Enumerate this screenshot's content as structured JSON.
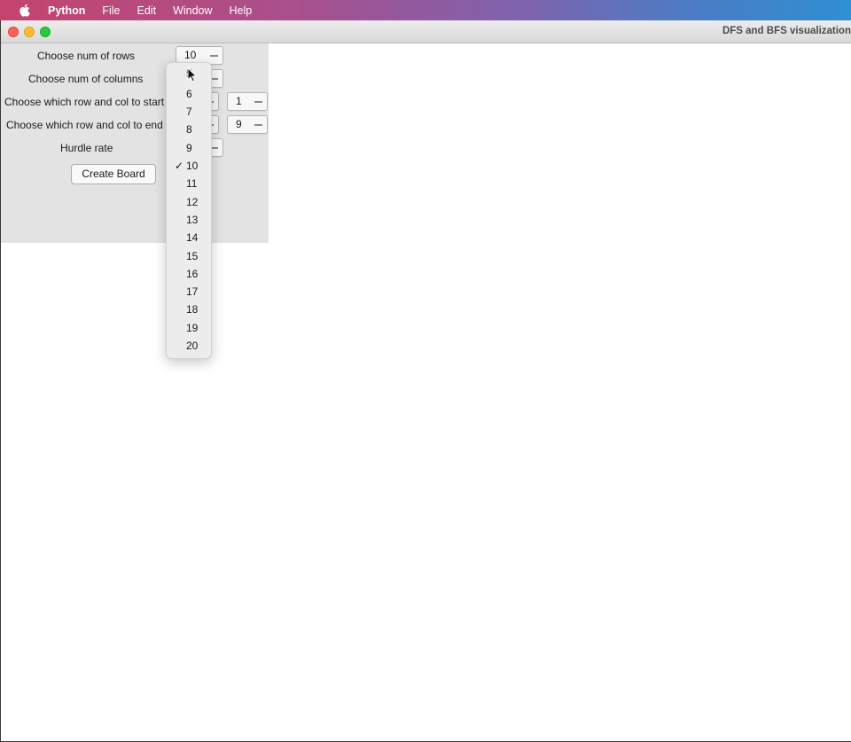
{
  "menubar": {
    "apple_icon": "apple-logo-icon",
    "items": [
      "Python",
      "File",
      "Edit",
      "Window",
      "Help"
    ]
  },
  "window": {
    "title": "DFS and BFS visualization"
  },
  "form": {
    "rows_label": "Choose num of rows",
    "rows_value": "10",
    "cols_label": "Choose num of columns",
    "start_label": "Choose which row and col to start",
    "start_col_value": "1",
    "end_label": "Choose which row and col to end",
    "end_col_value": "9",
    "hurdle_label": "Hurdle rate",
    "create_button": "Create Board"
  },
  "dropdown": {
    "options": [
      "5",
      "6",
      "7",
      "8",
      "9",
      "10",
      "11",
      "12",
      "13",
      "14",
      "15",
      "16",
      "17",
      "18",
      "19",
      "20"
    ],
    "selected": "10",
    "check_glyph": "✓"
  },
  "colors": {
    "panel_bg": "#e3e3e3",
    "menu_bg": "#ececec"
  }
}
